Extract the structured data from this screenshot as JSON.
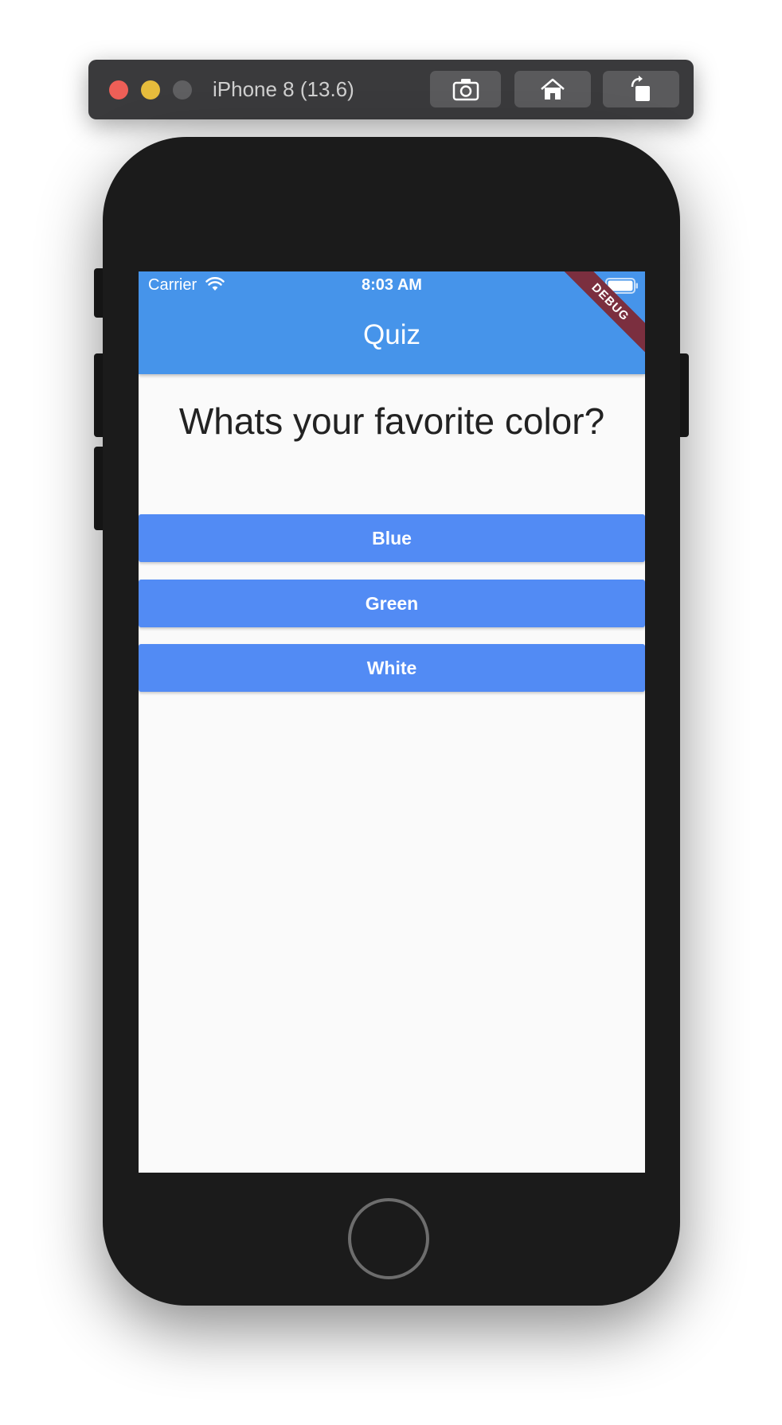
{
  "simulator": {
    "title": "iPhone 8 (13.6)",
    "toolbar_icons": [
      "screenshot-icon",
      "home-icon",
      "rotate-icon"
    ]
  },
  "status_bar": {
    "carrier": "Carrier",
    "time": "8:03 AM"
  },
  "app_bar": {
    "title": "Quiz",
    "color": "#4694ea"
  },
  "debug_banner": "DEBUG",
  "quiz": {
    "question": "Whats your favorite color?",
    "answers": [
      "Blue",
      "Green",
      "White"
    ],
    "button_color": "#528bf4"
  }
}
